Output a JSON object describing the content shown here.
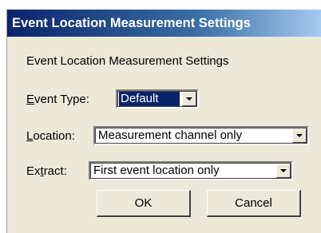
{
  "window": {
    "title": "Event Location Measurement Settings"
  },
  "dialog": {
    "heading": "Event Location Measurement Settings",
    "event_type": {
      "label_accel": "E",
      "label_rest": "vent Type:",
      "value": "Default"
    },
    "location": {
      "label_accel": "L",
      "label_rest": "ocation:",
      "value": "Measurement channel only"
    },
    "extract": {
      "label_pre": "Ex",
      "label_accel": "t",
      "label_rest": "ract:",
      "value": "First event location only"
    }
  },
  "buttons": {
    "ok": "OK",
    "cancel": "Cancel"
  }
}
